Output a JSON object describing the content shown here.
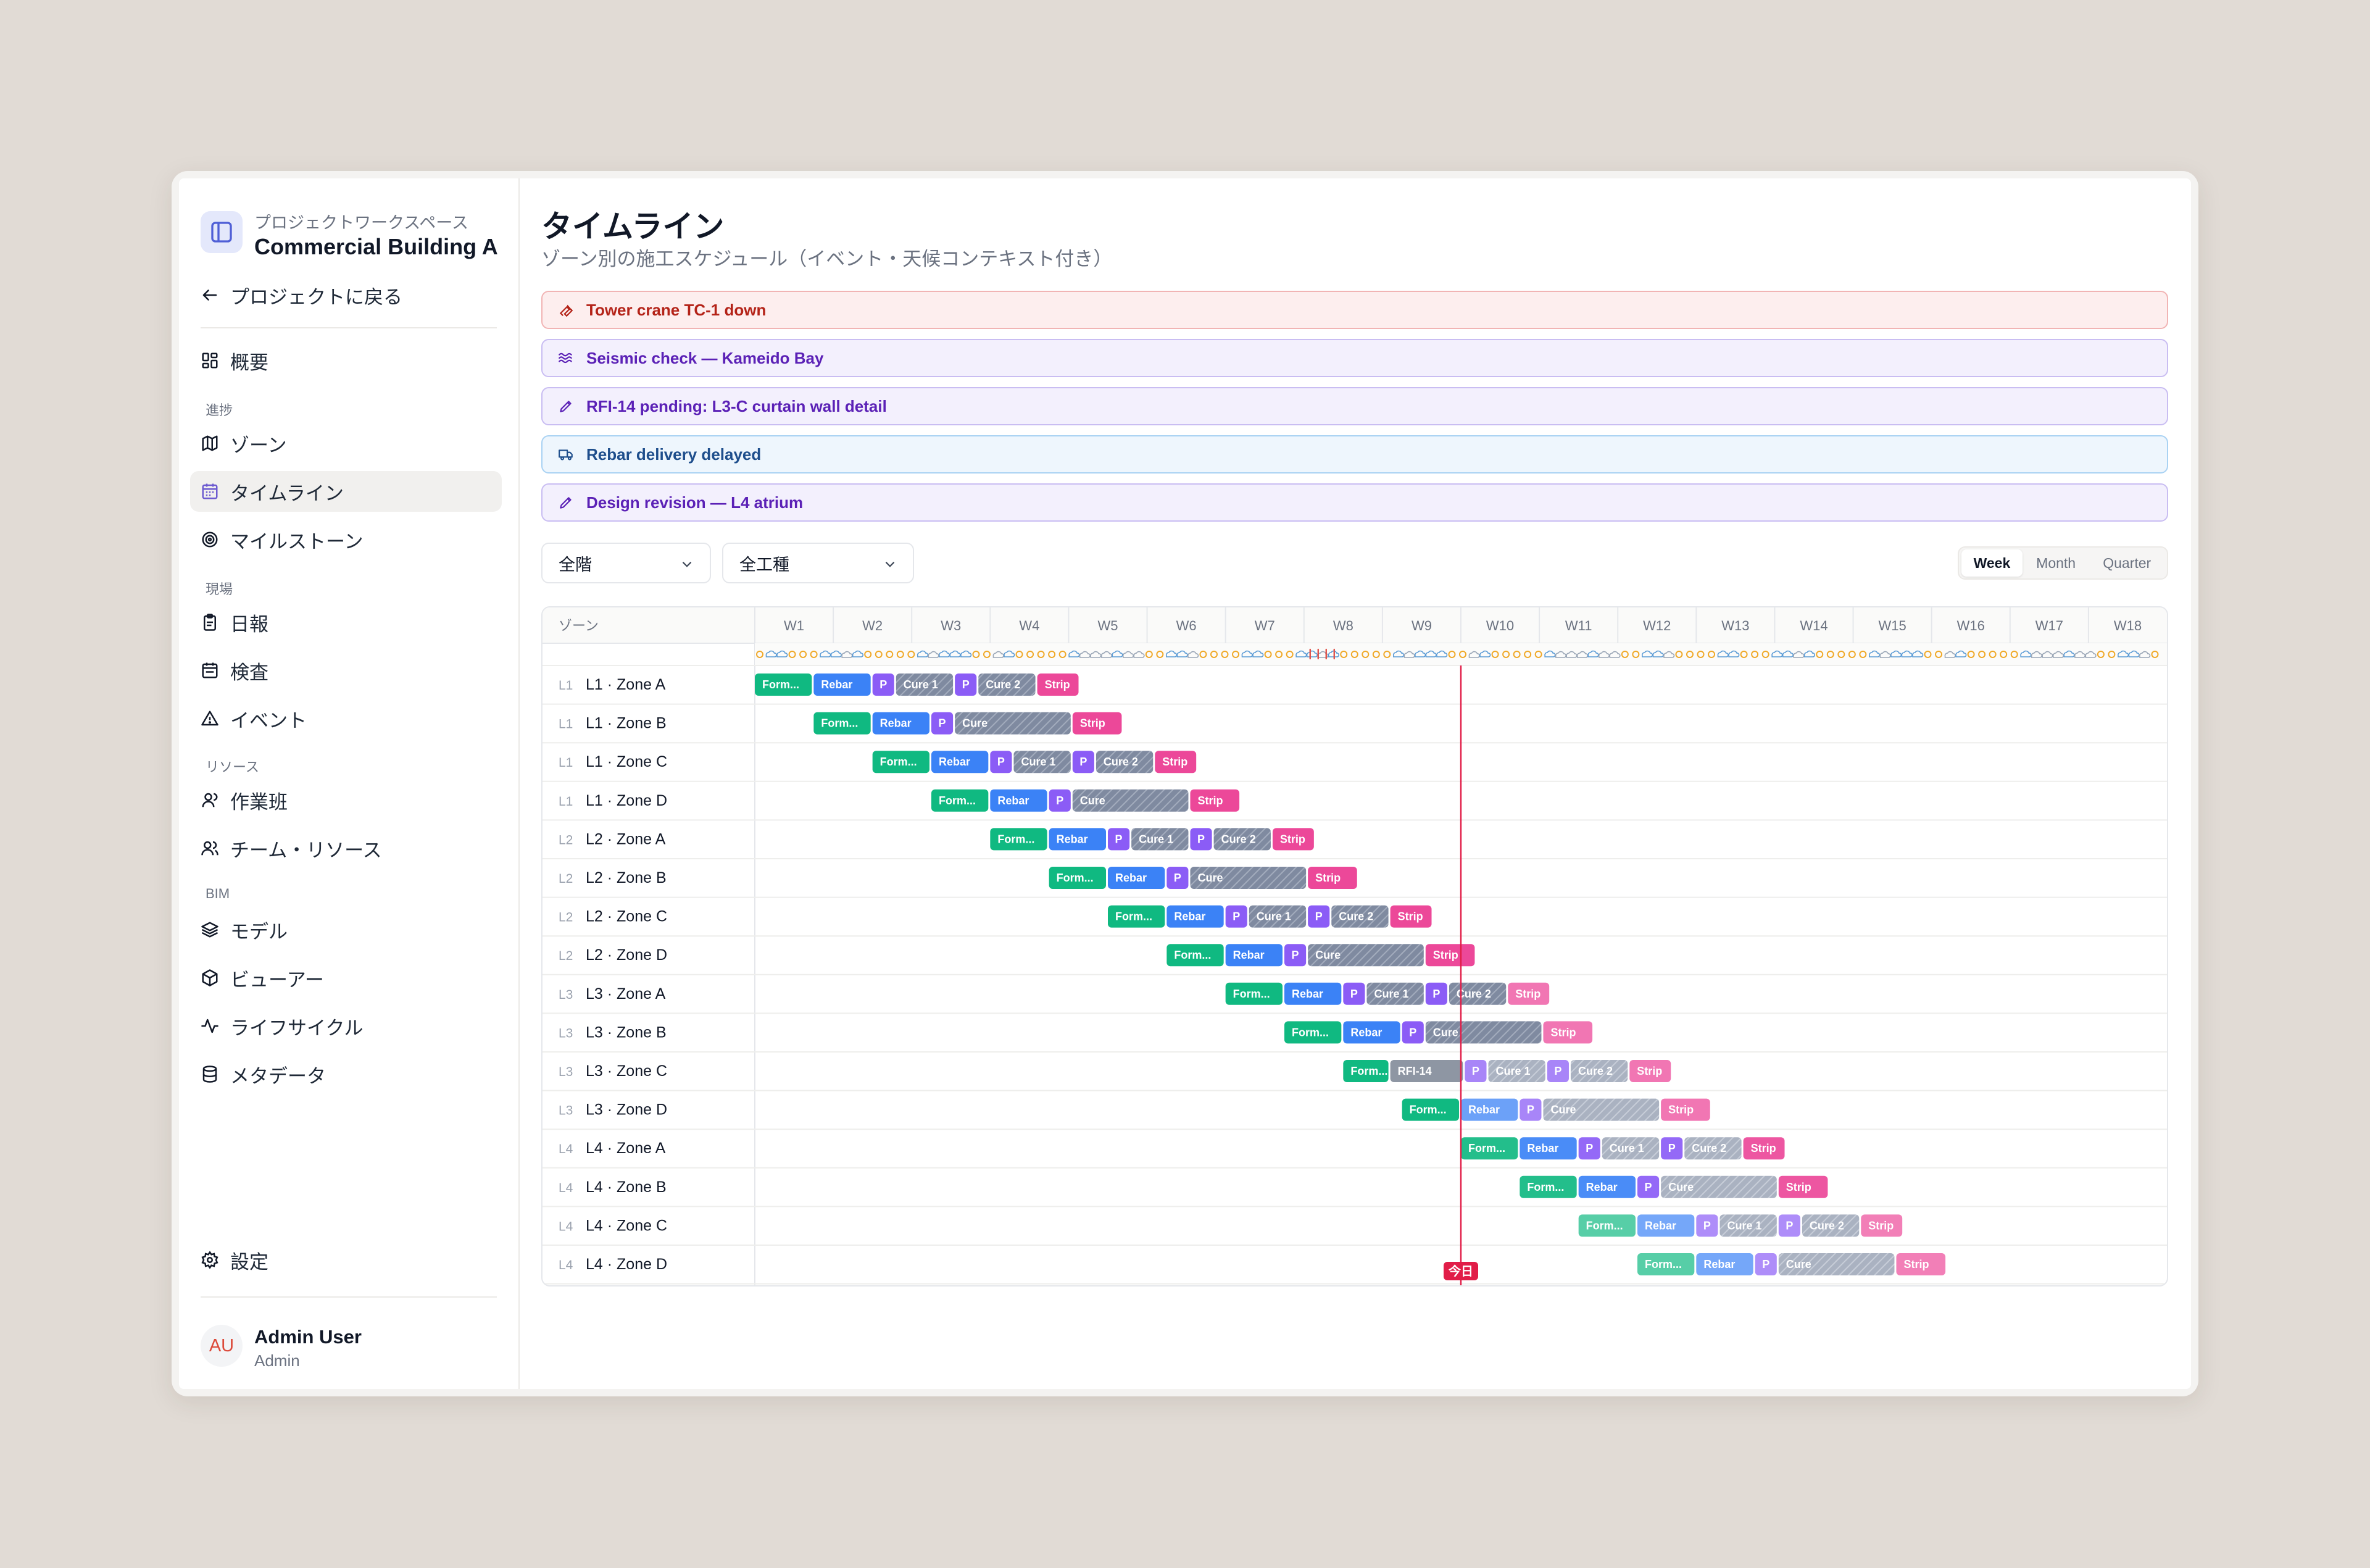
{
  "workspace": {
    "label": "プロジェクトワークスペース",
    "project": "Commercial Building A"
  },
  "sidebar": {
    "back": "プロジェクトに戻る",
    "overview": "概要",
    "sections": {
      "progress": "進捗",
      "site": "現場",
      "resources": "リソース",
      "bim": "BIM"
    },
    "items": {
      "zones": "ゾーン",
      "timeline": "タイムライン",
      "milestones": "マイルストーン",
      "daily": "日報",
      "inspection": "検査",
      "events": "イベント",
      "crews": "作業班",
      "teams": "チーム・リソース",
      "model": "モデル",
      "viewer": "ビューアー",
      "lifecycle": "ライフサイクル",
      "metadata": "メタデータ"
    },
    "settings": "設定",
    "user": {
      "initials": "AU",
      "name": "Admin User",
      "role": "Admin"
    }
  },
  "page": {
    "title": "タイムライン",
    "subtitle": "ゾーン別の施工スケジュール（イベント・天候コンテキスト付き）"
  },
  "alerts": [
    {
      "text": "Tower crane TC-1 down",
      "icon": "wrench-icon",
      "tone": "red",
      "bg": "#fdeeee",
      "border": "#f1b4b4",
      "color": "#b42318"
    },
    {
      "text": "Seismic check — Kameido Bay",
      "icon": "waves-icon",
      "tone": "purple",
      "bg": "#f3f0fd",
      "border": "#c9bdf2",
      "color": "#5b21b6"
    },
    {
      "text": "RFI-14 pending: L3-C curtain wall detail",
      "icon": "pencil-icon",
      "tone": "purple",
      "bg": "#f3f0fd",
      "border": "#c9bdf2",
      "color": "#5b21b6"
    },
    {
      "text": "Rebar delivery delayed",
      "icon": "truck-icon",
      "tone": "blue",
      "bg": "#eef6fd",
      "border": "#a9d2f3",
      "color": "#1e4e8c"
    },
    {
      "text": "Design revision — L4 atrium",
      "icon": "pencil-icon",
      "tone": "purple",
      "bg": "#f3f0fd",
      "border": "#c9bdf2",
      "color": "#5b21b6"
    }
  ],
  "filters": {
    "floor": "全階",
    "trade": "全工種"
  },
  "view_toggle": {
    "options": [
      "Week",
      "Month",
      "Quarter"
    ],
    "selected": "Week"
  },
  "timeline": {
    "zone_header": "ゾーン",
    "weeks": [
      "W1",
      "W2",
      "W3",
      "W4",
      "W5",
      "W6",
      "W7",
      "W8",
      "W9",
      "W10",
      "W11",
      "W12",
      "W13",
      "W14",
      "W15",
      "W16",
      "W17",
      "W18"
    ],
    "today_label": "今日",
    "today_week": 10.0,
    "colors": {
      "form": "#10b981",
      "rebar": "#3b82f6",
      "p": "#8b5cf6",
      "cure": "#8792a6",
      "strip": "#ec4899",
      "today": "#e11d48",
      "rfi": "#8e96a3"
    },
    "labels": {
      "form": "Form...",
      "rebar": "Rebar",
      "p": "P",
      "cure": "Cure",
      "cure1": "Cure 1",
      "cure2": "Cure 2",
      "strip": "Strip"
    },
    "zones": [
      {
        "floor": "L1",
        "name": "L1 · Zone A",
        "start": 1.0,
        "type": "full"
      },
      {
        "floor": "L1",
        "name": "L1 · Zone B",
        "start": 1.75,
        "type": "short"
      },
      {
        "floor": "L1",
        "name": "L1 · Zone C",
        "start": 2.5,
        "type": "full"
      },
      {
        "floor": "L1",
        "name": "L1 · Zone D",
        "start": 3.25,
        "type": "short"
      },
      {
        "floor": "L2",
        "name": "L2 · Zone A",
        "start": 4.0,
        "type": "full"
      },
      {
        "floor": "L2",
        "name": "L2 · Zone B",
        "start": 4.75,
        "type": "short"
      },
      {
        "floor": "L2",
        "name": "L2 · Zone C",
        "start": 5.5,
        "type": "full"
      },
      {
        "floor": "L2",
        "name": "L2 · Zone D",
        "start": 6.25,
        "type": "short"
      },
      {
        "floor": "L3",
        "name": "L3 · Zone A",
        "start": 7.0,
        "type": "full"
      },
      {
        "floor": "L3",
        "name": "L3 · Zone B",
        "start": 7.75,
        "type": "short"
      },
      {
        "floor": "L3",
        "name": "L3 · Zone C",
        "start": 8.5,
        "type": "rfi",
        "rfi_label": "RFI-14"
      },
      {
        "floor": "L3",
        "name": "L3 · Zone D",
        "start": 9.25,
        "type": "short"
      },
      {
        "floor": "L4",
        "name": "L4 · Zone A",
        "start": 10.0,
        "type": "full"
      },
      {
        "floor": "L4",
        "name": "L4 · Zone B",
        "start": 10.75,
        "type": "short"
      },
      {
        "floor": "L4",
        "name": "L4 · Zone C",
        "start": 11.5,
        "type": "full"
      },
      {
        "floor": "L4",
        "name": "L4 · Zone D",
        "start": 12.25,
        "type": "short"
      }
    ]
  }
}
